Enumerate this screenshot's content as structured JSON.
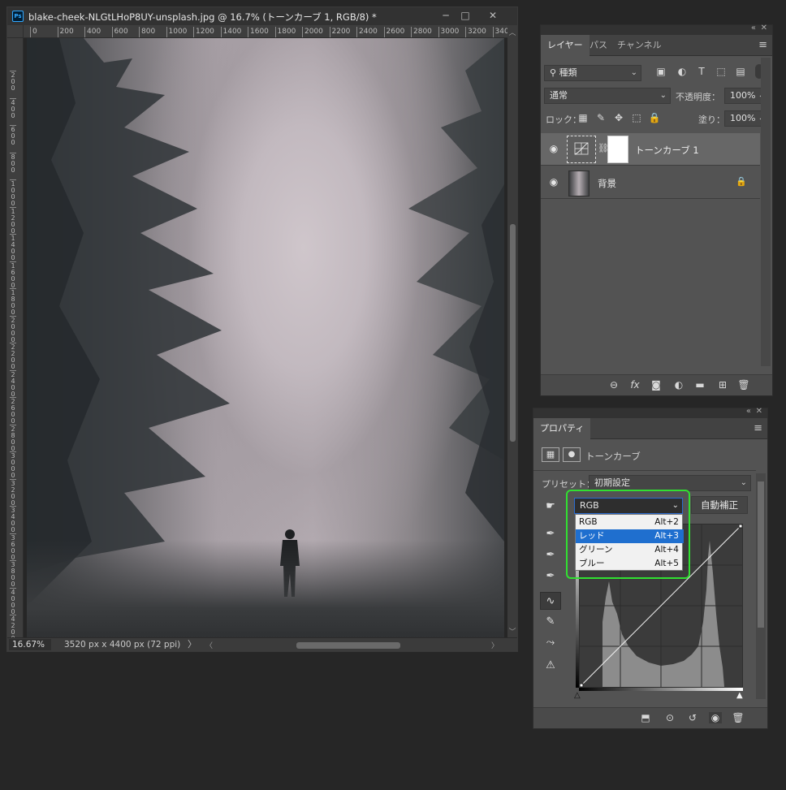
{
  "document": {
    "title": "blake-cheek-NLGtLHoP8UY-unsplash.jpg @ 16.7% (トーンカーブ 1, RGB/8) *",
    "app_badge": "Ps",
    "window_buttons": [
      "─",
      "□",
      "✕"
    ],
    "ruler_top": [
      "0",
      "200",
      "400",
      "600",
      "800",
      "1000",
      "1200",
      "1400",
      "1600",
      "1800",
      "2000",
      "2200",
      "2400",
      "2600",
      "2800",
      "3000",
      "3200",
      "340"
    ],
    "ruler_left": [
      "2\n0\n0",
      "4\n0\n0",
      "6\n0\n0",
      "8\n0\n0",
      "1\n0\n0\n0",
      "1\n2\n0\n0",
      "1\n4\n0\n0",
      "1\n6\n0\n0",
      "1\n8\n0\n0",
      "2\n0\n0\n0",
      "2\n2\n0\n0",
      "2\n4\n0\n0",
      "2\n6\n0\n0",
      "2\n8\n0\n0",
      "3\n0\n0\n0",
      "3\n2\n0\n0",
      "3\n4\n0\n0",
      "3\n6\n0\n0",
      "3\n8\n0\n0",
      "4\n0\n0\n0",
      "4\n2\n0\n0",
      "4\n4\n0\n0"
    ],
    "zoom": "16.67%",
    "size_info": "3520 px x 4400 px (72 ppi)",
    "status_chevron": "〉"
  },
  "layers_panel": {
    "tabs": [
      "レイヤー",
      "パス",
      "チャンネル"
    ],
    "active_tab": "レイヤー",
    "filter_label": "種類",
    "blend_mode": "通常",
    "opacity_label": "不透明度：",
    "opacity_value": "100%",
    "lock_label": "ロック：",
    "fill_label": "塗り：",
    "fill_value": "100%",
    "layers": [
      {
        "name": "トーンカーブ 1",
        "visible": true,
        "selected": true
      },
      {
        "name": "背景",
        "visible": true,
        "selected": false,
        "locked": true
      }
    ],
    "footer_icons": [
      "link-icon",
      "fx-icon",
      "mask-icon",
      "adjustment-icon",
      "folder-icon",
      "new-layer-icon",
      "trash-icon"
    ]
  },
  "properties_panel": {
    "tab": "プロパティ",
    "adjustment_name": "トーンカーブ",
    "preset_label": "プリセット：",
    "preset_value": "初期設定",
    "channel_value": "RGB",
    "auto_button": "自動補正",
    "channel_options": [
      {
        "label": "RGB",
        "shortcut": "Alt+2",
        "highlighted": false
      },
      {
        "label": "レッド",
        "shortcut": "Alt+3",
        "highlighted": true
      },
      {
        "label": "グリーン",
        "shortcut": "Alt+4",
        "highlighted": false
      },
      {
        "label": "ブルー",
        "shortcut": "Alt+5",
        "highlighted": false
      }
    ],
    "highlight_color": "#31e031",
    "selection_color": "#1f6fcf"
  }
}
